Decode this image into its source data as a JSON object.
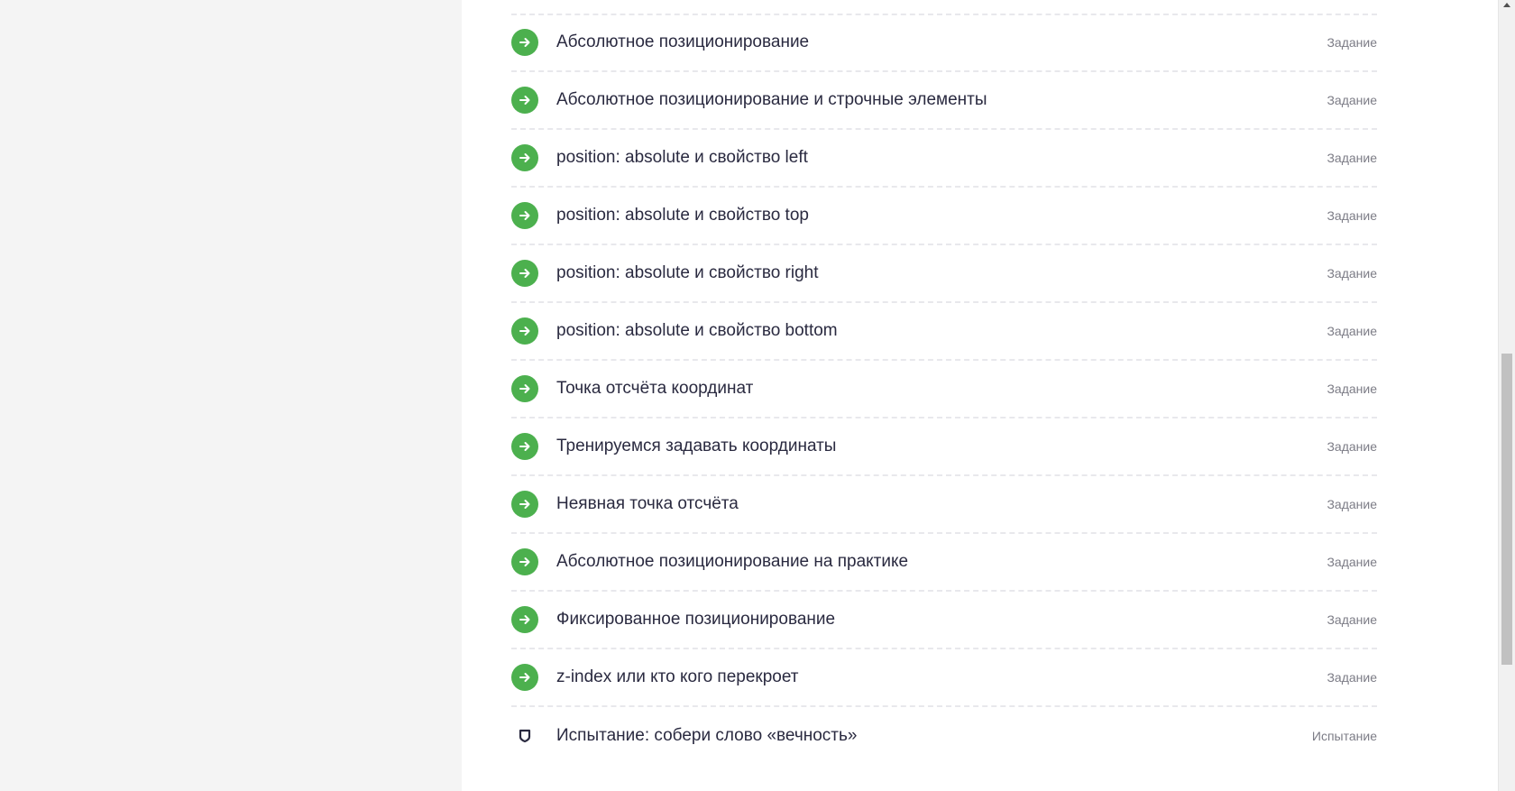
{
  "tasks": [
    {
      "title": "Абсолютное позиционирование",
      "type": "Задание",
      "icon": "arrow-right-icon"
    },
    {
      "title": "Абсолютное позиционирование и строчные элементы",
      "type": "Задание",
      "icon": "arrow-right-icon"
    },
    {
      "title": "position: absolute и свойство left",
      "type": "Задание",
      "icon": "arrow-right-icon"
    },
    {
      "title": "position: absolute и свойство top",
      "type": "Задание",
      "icon": "arrow-right-icon"
    },
    {
      "title": "position: absolute и свойство right",
      "type": "Задание",
      "icon": "arrow-right-icon"
    },
    {
      "title": "position: absolute и свойство bottom",
      "type": "Задание",
      "icon": "arrow-right-icon"
    },
    {
      "title": "Точка отсчёта координат",
      "type": "Задание",
      "icon": "arrow-right-icon"
    },
    {
      "title": "Тренируемся задавать координаты",
      "type": "Задание",
      "icon": "arrow-right-icon"
    },
    {
      "title": "Неявная точка отсчёта",
      "type": "Задание",
      "icon": "arrow-right-icon"
    },
    {
      "title": "Абсолютное позиционирование на практике",
      "type": "Задание",
      "icon": "arrow-right-icon"
    },
    {
      "title": "Фиксированное позиционирование",
      "type": "Задание",
      "icon": "arrow-right-icon"
    },
    {
      "title": "z-index или кто кого перекроет",
      "type": "Задание",
      "icon": "arrow-right-icon"
    },
    {
      "title": "Испытание: собери слово «вечность»",
      "type": "Испытание",
      "icon": "shield-icon"
    }
  ],
  "colors": {
    "accent_green": "#4cb04e",
    "title_text": "#2a2a40",
    "type_text": "#7c7c86",
    "page_bg": "#f4f4f4",
    "panel_bg": "#ffffff"
  },
  "scrollbar": {
    "scroll_position": 0.58
  }
}
